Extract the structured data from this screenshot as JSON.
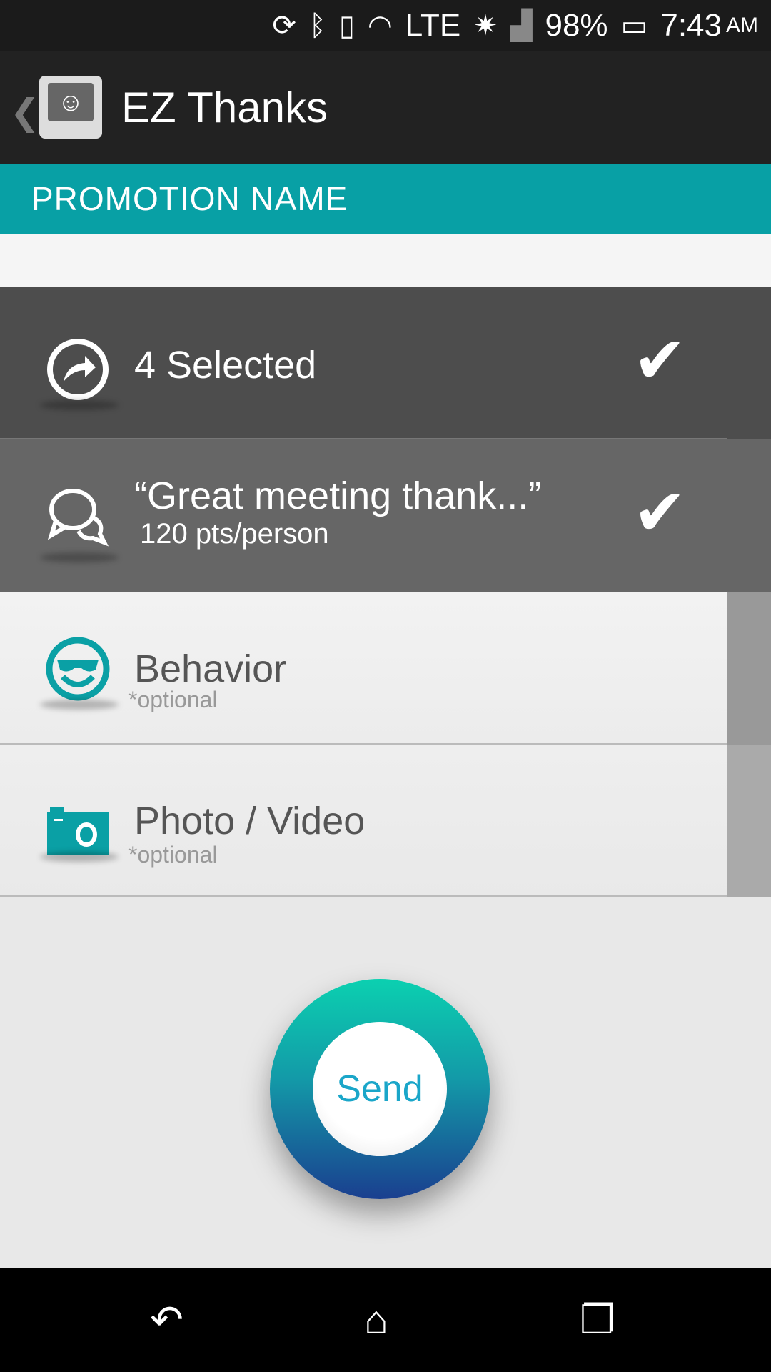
{
  "status_bar": {
    "lte": "LTE",
    "battery": "98%",
    "time": "7:43",
    "ampm": "AM"
  },
  "app_bar": {
    "title": "EZ Thanks"
  },
  "section_header": "PROMOTION NAME",
  "rows": [
    {
      "title": "4 Selected",
      "icon": "share-arrow-icon",
      "checked": true
    },
    {
      "title": "“Great meeting thank...”",
      "subtitle": "120 pts/person",
      "icon": "chat-bubbles-icon",
      "checked": true
    },
    {
      "title": "Behavior",
      "subtitle": "*optional",
      "icon": "sunglasses-smiley-icon"
    },
    {
      "title": "Photo / Video",
      "subtitle": "*optional",
      "icon": "camera-icon"
    }
  ],
  "send_label": "Send",
  "colors": {
    "accent": "#08a0a5",
    "send_text": "#1aa6c9"
  }
}
